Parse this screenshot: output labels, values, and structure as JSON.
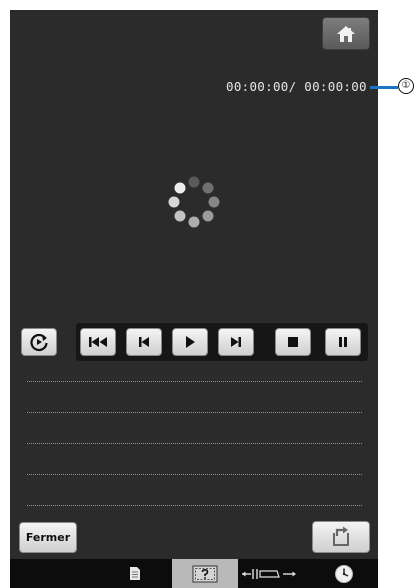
{
  "player": {
    "timecode_current": "00:00:00",
    "timecode_total": "00:00:00",
    "timecode_separator": "/ "
  },
  "callout": {
    "label": "①"
  },
  "footer": {
    "close_label": "Fermer"
  },
  "icons": {
    "home": "home-icon",
    "repeat": "repeat-icon",
    "rewind": "skip-to-start-icon",
    "previous": "previous-icon",
    "play": "play-icon",
    "next": "next-icon",
    "stop": "stop-icon",
    "pause": "pause-icon",
    "return": "return-icon",
    "document": "document-icon",
    "help": "help-icon",
    "width": "width-icon",
    "clock": "clock-icon"
  },
  "colors": {
    "screen_bg": "#2b2b2b",
    "callout_line": "#1f73c4"
  }
}
